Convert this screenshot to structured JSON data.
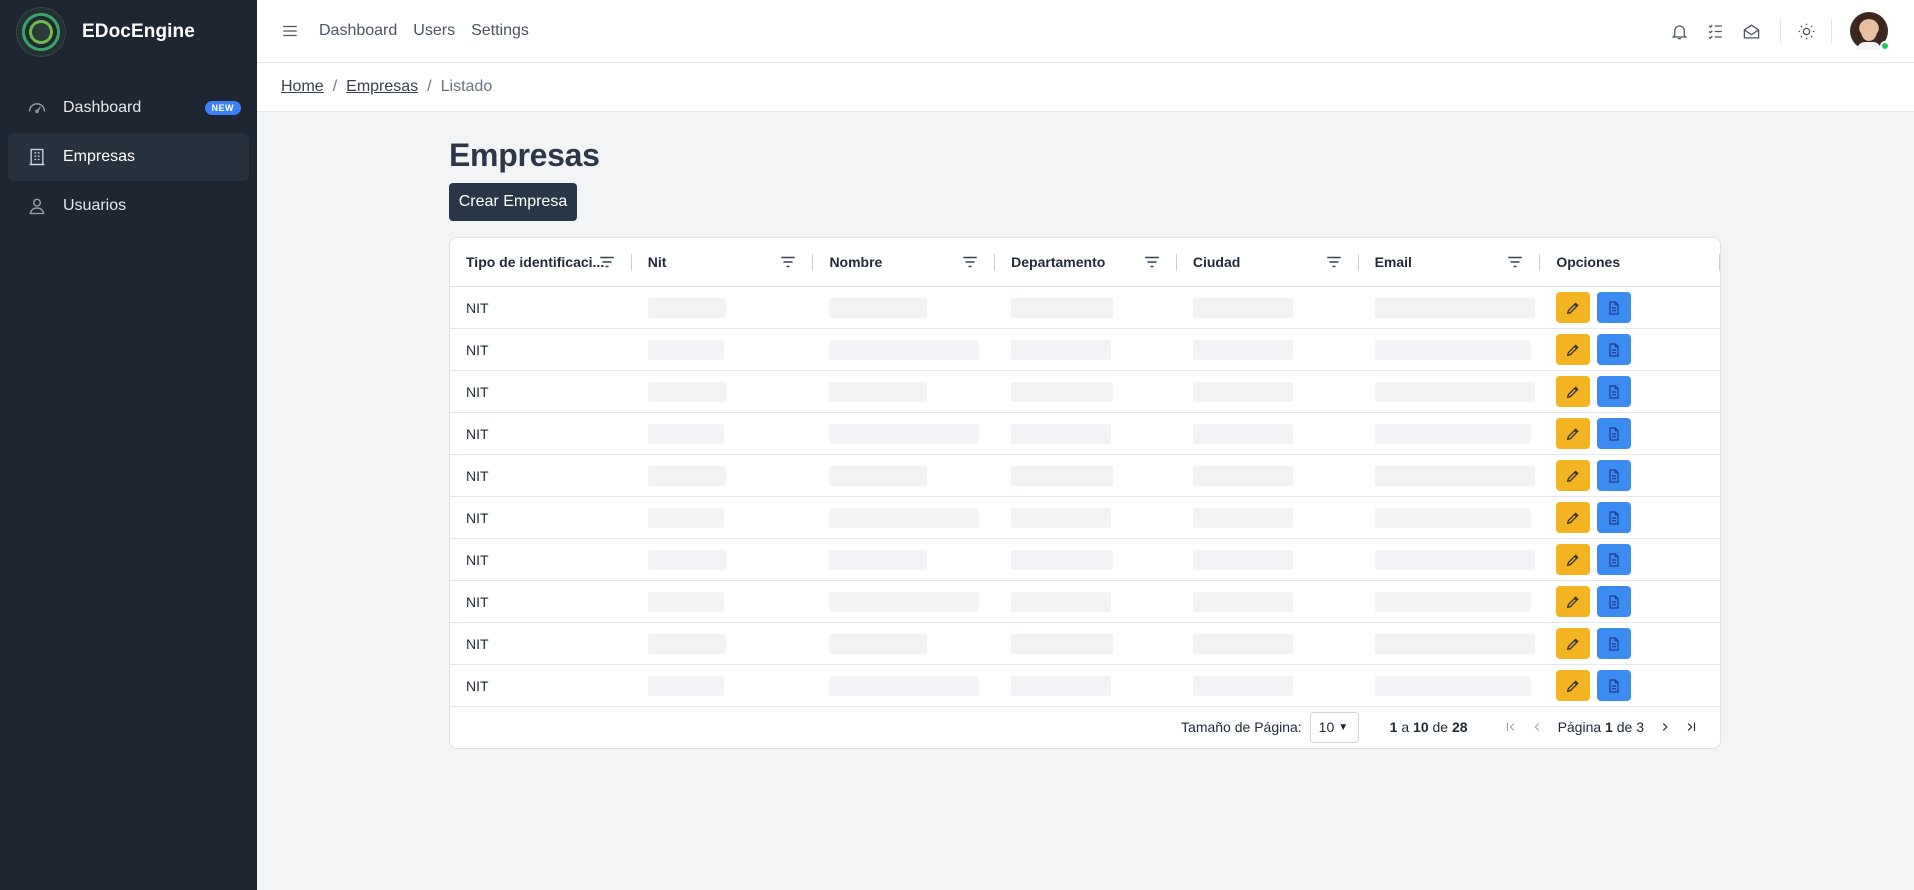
{
  "sidebar": {
    "brand": "EDocEngine",
    "items": [
      {
        "label": "Dashboard",
        "icon": "gauge-icon",
        "badge": "NEW"
      },
      {
        "label": "Empresas",
        "icon": "building-icon",
        "active": true
      },
      {
        "label": "Usuarios",
        "icon": "user-icon"
      }
    ]
  },
  "topbar": {
    "links": [
      "Dashboard",
      "Users",
      "Settings"
    ],
    "icons": [
      "bell-icon",
      "checklist-icon",
      "mail-open-icon",
      "sun-icon"
    ]
  },
  "breadcrumb": {
    "home": "Home",
    "section": "Empresas",
    "current": "Listado"
  },
  "page": {
    "title": "Empresas",
    "create_button": "Crear Empresa"
  },
  "table": {
    "columns": [
      "Tipo de identificaci...",
      "Nit",
      "Nombre",
      "Departamento",
      "Ciudad",
      "Email",
      "Opciones"
    ],
    "rows": [
      {
        "tipo": "NIT"
      },
      {
        "tipo": "NIT"
      },
      {
        "tipo": "NIT"
      },
      {
        "tipo": "NIT"
      },
      {
        "tipo": "NIT"
      },
      {
        "tipo": "NIT"
      },
      {
        "tipo": "NIT"
      },
      {
        "tipo": "NIT"
      },
      {
        "tipo": "NIT"
      },
      {
        "tipo": "NIT"
      }
    ]
  },
  "pagination": {
    "page_size_label": "Tamaño de Página:",
    "page_size": "10",
    "range_from": "1",
    "range_to": "10",
    "range_total": "28",
    "range_word_a": "a",
    "range_word_de": "de",
    "page_word": "Página",
    "current_page": "1",
    "of_word": "de",
    "total_pages": "3"
  },
  "colors": {
    "sidebar": "#1e2631",
    "edit_button": "#f4b321",
    "doc_button": "#3b8bf0",
    "create_button": "#283747",
    "badge": "#3b82f6"
  }
}
